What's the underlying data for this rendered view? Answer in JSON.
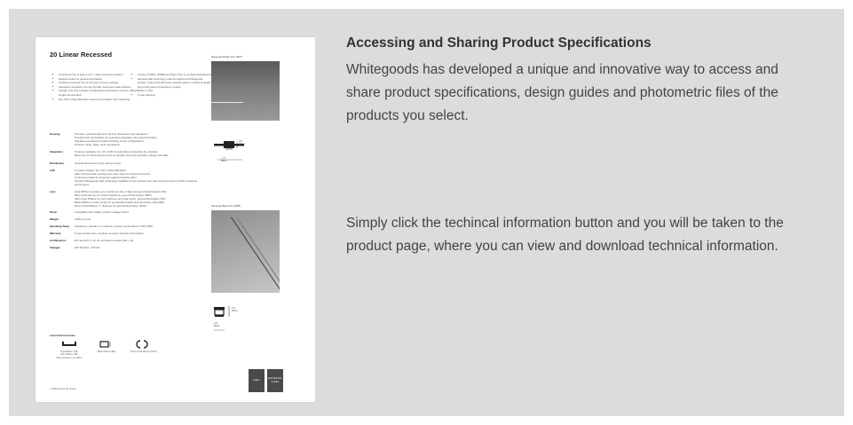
{
  "sheet": {
    "title": "20 Linear Recessed",
    "bullets_left": [
      "Continuous line of light in a 0.7\" wide recessed extrusion.",
      "Multiple lenses for general illumination.",
      "Trimless and bezel trim for all types of home settings.",
      "Seamless integration into any drywall, wood and metal surfaces.",
      "Straight runs and complex configurations with factory corners in exact lengths as specified.",
      "90+ CRI, 3-Step MacAdam delivering excellent color rendering."
    ],
    "bullets_right": [
      "Choice of White, RGBW and Warm Dim to emulate incandescent.",
      "Identical LED technology used throughout all Whitegoods Linears, Cases and Perimeter products deliver consistent quality and performance throughout a project.",
      "Made in USA.",
      "5 year warranty."
    ],
    "specs": [
      {
        "label": "Housing",
        "value": "Precision extruded aluminum for true dimensions and tolerances\nProvided with all hardware for seamless integration into selected surface\nStandard and tailored lengths including corner configurations\nFinishes: white, black, clear anodization"
      },
      {
        "label": "Integration",
        "value": "Trimless installation for 1/2\" & 5/8\" drywall without disrupting the structure\nBezel trim for hard surfaces such as drywall, wood and specialty ceilings and walls"
      },
      {
        "label": "Distribution",
        "value": "General illumination using various lenses"
      },
      {
        "label": "LED",
        "value": "Constant Voltage, 90+ CRI, 3-Step MacAdam\nLED minimum/cash average (see spec sheet for delivered lumens)\nConformal coated for protection against humidity (IDL)\nIdentical Whitegoods LED technology available across all linear and case systems ensures 100% consistent performance"
      },
      {
        "label": "Lens",
        "value": "Opal Diffuser provides even continuous line of light and general illumination (OD)\nMicro-prismatic lens for lower brightness, general illumination (MPL)\nSatin Clear Diffuser for high efficiency and edge beam, general illumination (SD)\nBlack Diffuser of satin acrylic for general illumination and decorative effect (BD)\nRound Opal Diffuser, 1\" diameter for general illumination (ROD)"
      },
      {
        "label": "Driver",
        "value": "Compatible with quality constant voltage drivers"
      },
      {
        "label": "Weight",
        "value": "0.9lbs per foot"
      },
      {
        "label": "Operating Temp",
        "value": "Suitable for operation in maximum ambient temperature of 35C (95F)"
      },
      {
        "label": "Warranty",
        "value": "5 year Limited (see complete company warranty information)"
      },
      {
        "label": "Certifications",
        "value": "ETL and ETL-C for dry and damp location (IDL), CE"
      },
      {
        "label": "Voltages",
        "value": "24V DC/VAC, 347VAC"
      }
    ],
    "photo1_caption": "Recessed Plaster Trim (RPT)",
    "photo2_caption": "Recessed Bezel Trim (RBT)",
    "dim1_top": "0.8\"\n20mm",
    "dim1_bottom": "1.4\"\n36mm",
    "dim2_top": "2.6\"\n66mm",
    "dim2_side": "1.8\"\n45mm",
    "lenses_title": "Lenses/Accessories",
    "lenses": [
      {
        "caption": "Opal Diffuser (OD)\nSatin Diffuser (SD)\nMicro-prismatic Lens (MPL)"
      },
      {
        "caption": "Black Diffuser (BD)"
      },
      {
        "caption": "Round Opal Diffuser (ROD)"
      }
    ],
    "footer": "1   Whitegoods 20 Linear",
    "btn_index": "index",
    "btn_tech": "technical info-rmation"
  },
  "text": {
    "heading": "Accessing and Sharing Product Specifications",
    "para1": "Whitegoods has developed a unique and innovative way to access and share product specifications, design guides and photometric files of the products you select.",
    "para2": "Simply click the techincal information button and you will be taken to the product page, where you can view and download technical information."
  }
}
